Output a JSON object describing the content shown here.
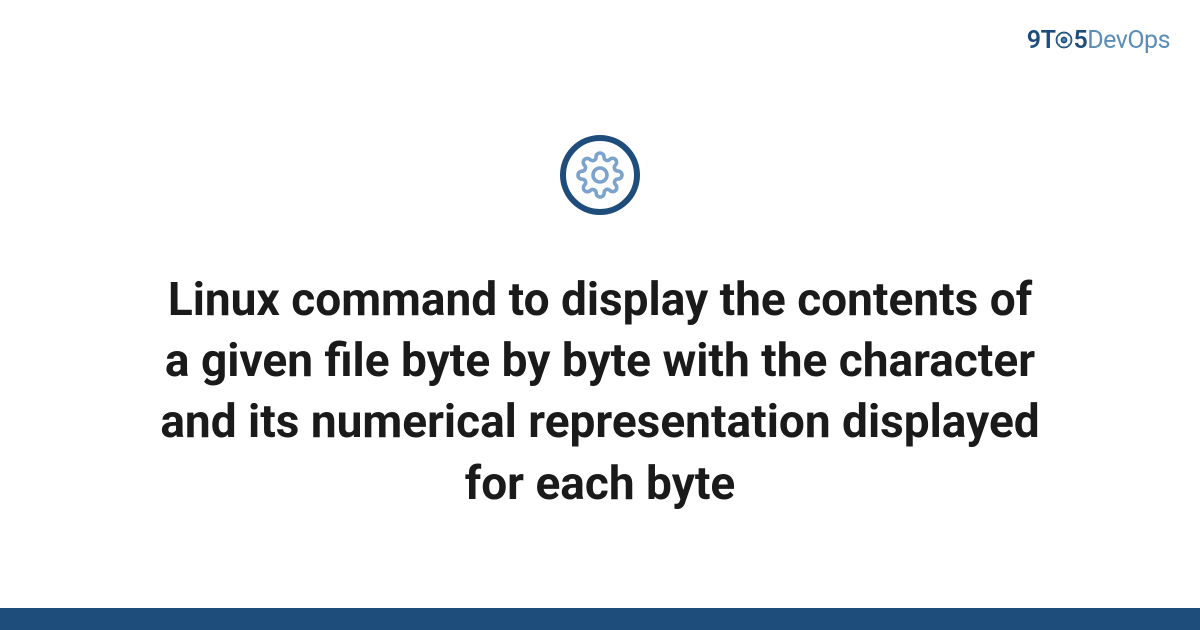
{
  "logo": {
    "part1": "9T",
    "part2": "5",
    "part3": "DevOps"
  },
  "title": "Linux command to display the contents of a given file byte by byte with the character and its numerical representation displayed for each byte",
  "colors": {
    "primary": "#1e4d7b",
    "secondary": "#5a8db8",
    "text": "#1a1a1a",
    "background": "#ffffff"
  }
}
